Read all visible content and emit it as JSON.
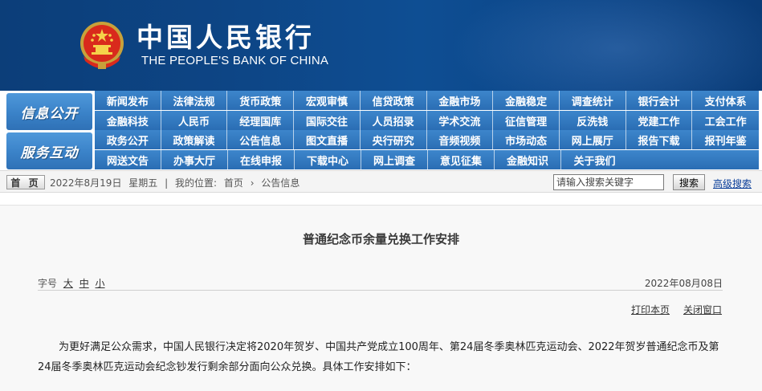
{
  "header": {
    "brand_cn": "中国人民银行",
    "brand_en": "THE PEOPLE'S BANK OF CHINA",
    "emblem_icon": "national-emblem-icon",
    "background_color": "#0d4585"
  },
  "nav": {
    "info_label": "信息公开",
    "service_label": "服务互动",
    "rows": [
      [
        "新闻发布",
        "法律法规",
        "货币政策",
        "宏观审慎",
        "信贷政策",
        "金融市场",
        "金融稳定",
        "调查统计",
        "银行会计",
        "支付体系"
      ],
      [
        "金融科技",
        "人民币",
        "经理国库",
        "国际交往",
        "人员招录",
        "学术交流",
        "征信管理",
        "反洗钱",
        "党建工作",
        "工会工作"
      ],
      [
        "政务公开",
        "政策解读",
        "公告信息",
        "图文直播",
        "央行研究",
        "音频视频",
        "市场动态",
        "网上展厅",
        "报告下载",
        "报刊年鉴"
      ],
      [
        "网送文告",
        "办事大厅",
        "在线申报",
        "下载中心",
        "网上调查",
        "意见征集",
        "金融知识",
        "关于我们"
      ]
    ],
    "accent_blue": "#2a6db4",
    "light_row_text": "#0b3f80"
  },
  "location_bar": {
    "home_label": "首 页",
    "date": "2022年8月19日",
    "weekday": "星期五",
    "separator": "|",
    "location_prefix": "我的位置:",
    "breadcrumb_home": "首页",
    "breadcrumb_arrow": "›",
    "breadcrumb_current": "公告信息",
    "search_placeholder": "请输入搜索关键字",
    "search_button": "搜索",
    "advanced_search": "高级搜索"
  },
  "article": {
    "title": "普通纪念币余量兑换工作安排",
    "font_size_label": "字号",
    "font_large": "大",
    "font_medium": "中",
    "font_small": "小",
    "date": "2022年08月08日",
    "print_label": "打印本页",
    "close_label": "关闭窗口",
    "body": "为更好满足公众需求，中国人民银行决定将2020年贺岁、中国共产党成立100周年、第24届冬季奥林匹克运动会、2022年贺岁普通纪念币及第24届冬季奥林匹克运动会纪念钞发行剩余部分面向公众兑换。具体工作安排如下："
  }
}
